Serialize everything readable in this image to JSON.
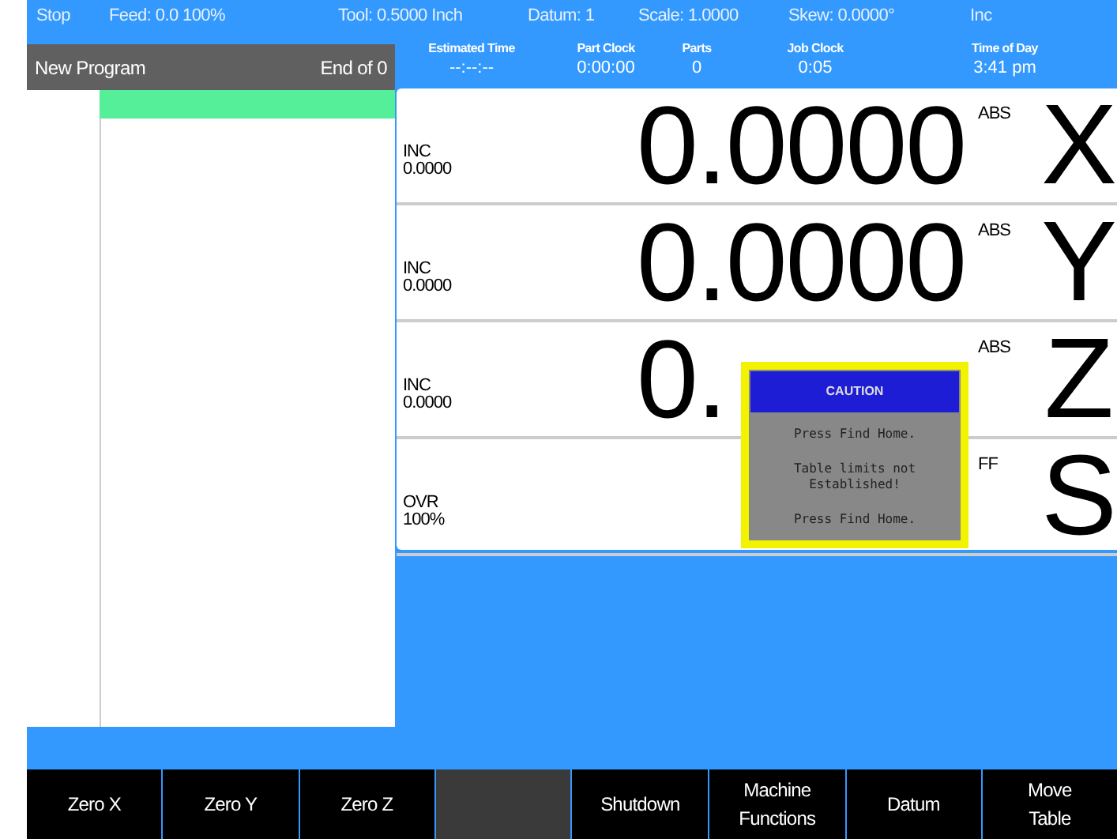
{
  "status_bar": {
    "items": [
      "Stop",
      "Feed:  0.0 100%",
      "Tool: 0.5000 Inch",
      "Datum: 1",
      "Scale: 1.0000",
      "Skew: 0.0000°",
      "Inc"
    ]
  },
  "program": {
    "title": "New Program",
    "position": "End of 0",
    "rows": [
      {
        "selected": true
      }
    ]
  },
  "clocks": [
    {
      "label": "Estimated Time",
      "value": "--:--:--"
    },
    {
      "label": "Part Clock",
      "value": "0:00:00"
    },
    {
      "label": "Parts",
      "value": "0"
    },
    {
      "label": "Job Clock",
      "value": "0:05"
    },
    {
      "label": "Time of Day",
      "value": "3:41 pm"
    }
  ],
  "axes": [
    {
      "label": "INC",
      "reading": "0.0000",
      "value": "0.0000",
      "mode": "ABS",
      "axis": "X"
    },
    {
      "label": "INC",
      "reading": "0.0000",
      "value": "0.0000",
      "mode": "ABS",
      "axis": "Y"
    },
    {
      "label": "INC",
      "reading": "0.0000",
      "value": "0.",
      "mode": "ABS",
      "axis": "Z"
    },
    {
      "label": "OVR",
      "reading": "100%",
      "mode": "FF",
      "axis": "S"
    }
  ],
  "dialog": {
    "title": "CAUTION",
    "lines": [
      "Press Find Home.",
      "Table limits not Established!",
      "Press Find Home."
    ]
  },
  "softkeys": [
    {
      "label": "Zero X",
      "disabled": false
    },
    {
      "label": "Zero Y",
      "disabled": false
    },
    {
      "label": "Zero Z",
      "disabled": false
    },
    {
      "disabled": true
    },
    {
      "label": "Shutdown",
      "disabled": false
    },
    {
      "label": "Machine Functions",
      "disabled": false
    },
    {
      "label": "Datum",
      "disabled": false
    },
    {
      "label": "Move Table",
      "disabled": false
    }
  ]
}
